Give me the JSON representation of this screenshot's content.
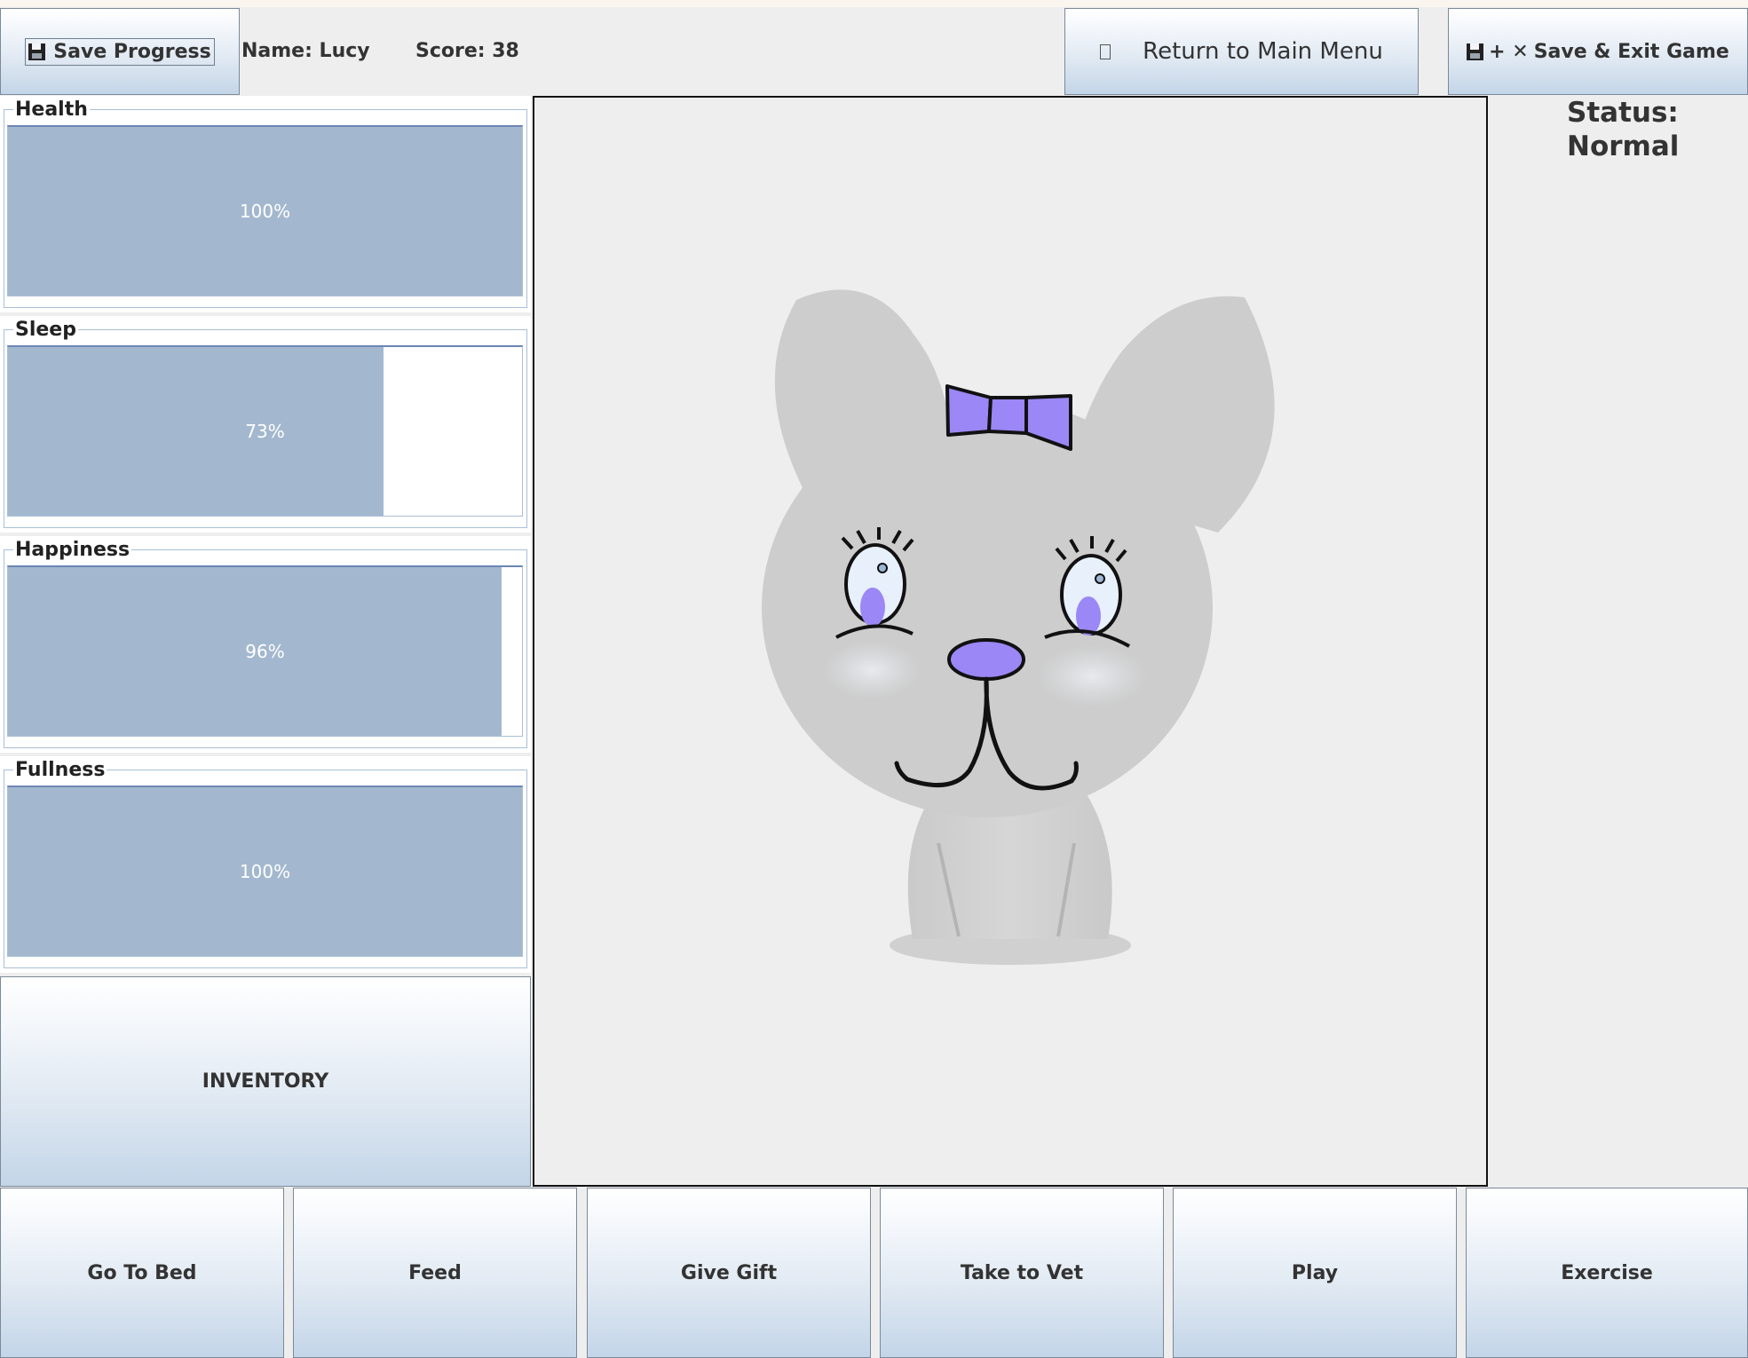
{
  "header": {
    "save_progress_label": "Save Progress",
    "name_text": "Name: Lucy",
    "score_text": "Score: 38",
    "main_menu_label": "Return to Main Menu",
    "save_exit_label": "Save & Exit Game",
    "save_exit_prefix": "+ ✕"
  },
  "stats": [
    {
      "label": "Health",
      "value": 100,
      "text": "100%"
    },
    {
      "label": "Sleep",
      "value": 73,
      "text": "73%"
    },
    {
      "label": "Happiness",
      "value": 96,
      "text": "96%"
    },
    {
      "label": "Fullness",
      "value": 100,
      "text": "100%"
    }
  ],
  "inventory_label": "INVENTORY",
  "status": {
    "line1": "Status:",
    "line2": "Normal"
  },
  "actions": [
    "Go To Bed",
    "Feed",
    "Give Gift",
    "Take to Vet",
    "Play",
    "Exercise"
  ],
  "pet": {
    "body_color": "#cfcfcf",
    "accent_color": "#9b87f5",
    "eye_white": "#e8f1fb",
    "icons": [
      "floppy-disk-icon",
      "box-icon",
      "bow-icon"
    ]
  },
  "colors": {
    "bar_fill": "#a3b8ce",
    "bar_border": "#6b86b5",
    "button_gradient_top": "#ffffff",
    "button_gradient_bottom": "#c3d5e8"
  }
}
